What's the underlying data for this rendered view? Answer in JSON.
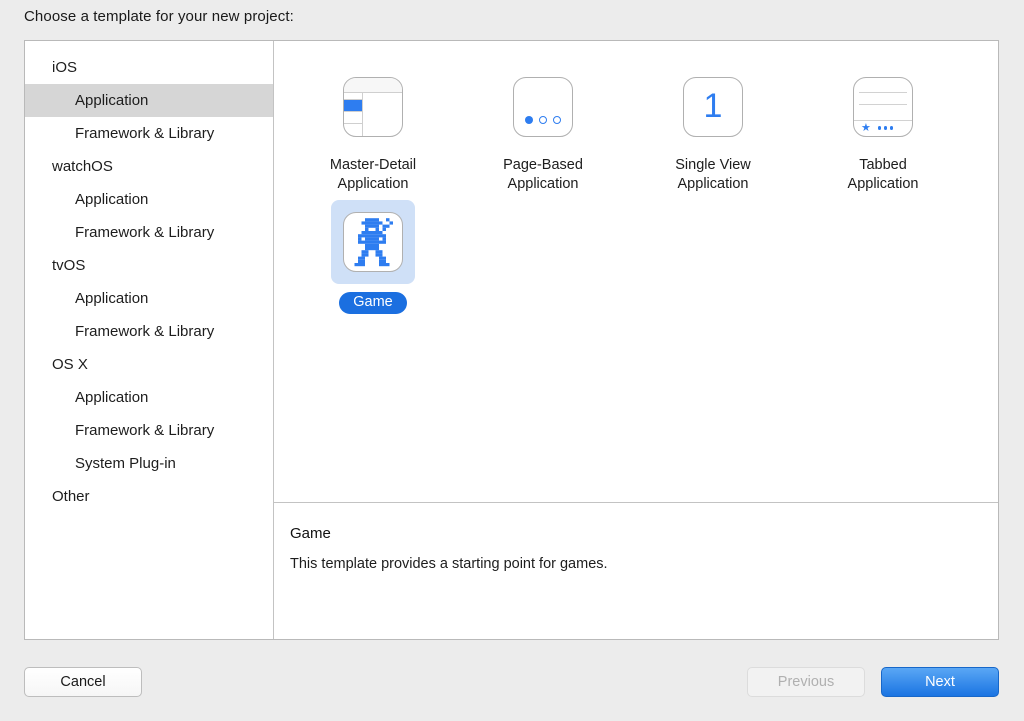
{
  "header": {
    "title": "Choose a template for your new project:"
  },
  "sidebar": {
    "items": [
      {
        "label": "iOS",
        "level": "group",
        "selected": false
      },
      {
        "label": "Application",
        "level": "child",
        "selected": true
      },
      {
        "label": "Framework & Library",
        "level": "child",
        "selected": false
      },
      {
        "label": "watchOS",
        "level": "group",
        "selected": false
      },
      {
        "label": "Application",
        "level": "child",
        "selected": false
      },
      {
        "label": "Framework & Library",
        "level": "child",
        "selected": false
      },
      {
        "label": "tvOS",
        "level": "group",
        "selected": false
      },
      {
        "label": "Application",
        "level": "child",
        "selected": false
      },
      {
        "label": "Framework & Library",
        "level": "child",
        "selected": false
      },
      {
        "label": "OS X",
        "level": "group",
        "selected": false
      },
      {
        "label": "Application",
        "level": "child",
        "selected": false
      },
      {
        "label": "Framework & Library",
        "level": "child",
        "selected": false
      },
      {
        "label": "System Plug-in",
        "level": "child",
        "selected": false
      },
      {
        "label": "Other",
        "level": "group",
        "selected": false
      }
    ]
  },
  "templates": [
    {
      "label": "Master-Detail\nApplication",
      "icon": "master-detail-icon",
      "selected": false
    },
    {
      "label": "Page-Based\nApplication",
      "icon": "page-based-icon",
      "selected": false
    },
    {
      "label": "Single View\nApplication",
      "icon": "single-view-icon",
      "selected": false
    },
    {
      "label": "Tabbed\nApplication",
      "icon": "tabbed-icon",
      "selected": false
    },
    {
      "label": "Game",
      "icon": "game-robot-icon",
      "selected": true
    }
  ],
  "single_view_glyph": "1",
  "description": {
    "title": "Game",
    "body": "This template provides a starting point for games."
  },
  "footer": {
    "cancel_label": "Cancel",
    "previous_label": "Previous",
    "next_label": "Next"
  },
  "colors": {
    "accent_blue": "#2e7df0",
    "selection_blue": "#1b6fe0",
    "selection_tile_bg": "#cfe0f7",
    "sidebar_selection": "#d6d6d6",
    "window_bg": "#ececec"
  }
}
